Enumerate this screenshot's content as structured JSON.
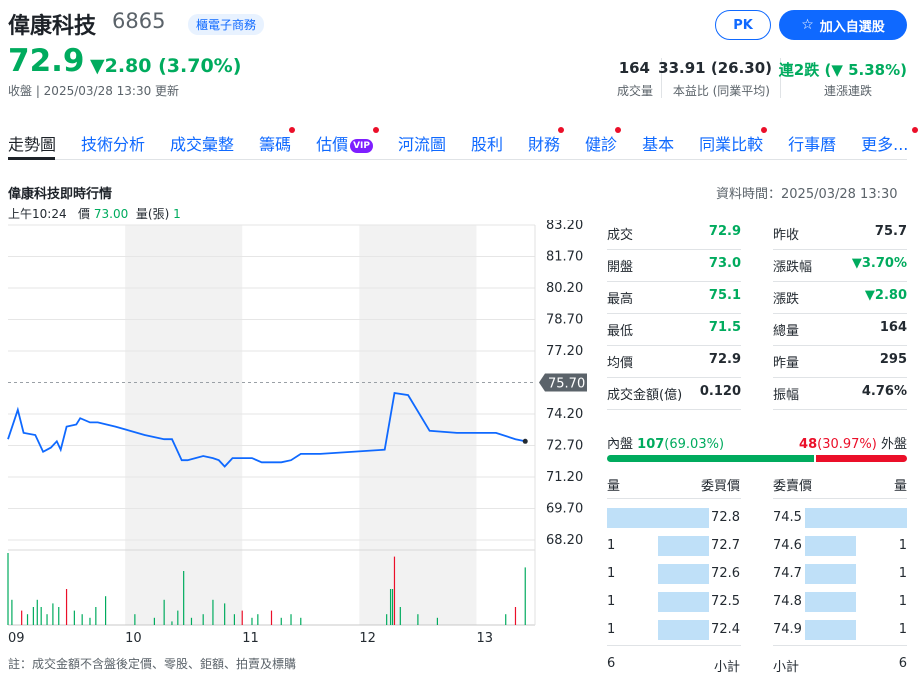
{
  "header": {
    "name": "偉康科技",
    "code": "6865",
    "sector": "櫃電子商務",
    "pk_label": "PK",
    "watch_label": "加入自選股",
    "price": "72.9",
    "change": "▼2.80 (3.70%)",
    "status": "收盤 | 2025/03/28 13:30 更新",
    "stats": [
      {
        "value": "164",
        "label": "成交量"
      },
      {
        "value": "33.91 (26.30)",
        "label": "本益比 (同業平均)"
      },
      {
        "value_prefix": "連2跌 (",
        "value_arrow": "▼",
        "value_main": "5.38%)",
        "label": "連漲連跌"
      }
    ]
  },
  "tabs": [
    "走勢圖",
    "技術分析",
    "成交彙整",
    "籌碼",
    "估價",
    "河流圖",
    "股利",
    "財務",
    "健診",
    "基本",
    "同業比較",
    "行事曆",
    "更多..."
  ],
  "vip_label": "VIP",
  "section": {
    "title": "偉康科技即時行情",
    "data_time": "資料時間：2025/03/28 13:30",
    "crosshair_time": "上午10:24",
    "crosshair_price_label": "價",
    "crosshair_price": "73.00",
    "crosshair_vol_label": "量(張)",
    "crosshair_vol": "1"
  },
  "chart_data": {
    "type": "line",
    "x_ticks": [
      "09",
      "10",
      "11",
      "12",
      "13"
    ],
    "y_ticks": [
      83.2,
      81.7,
      80.2,
      78.7,
      77.2,
      74.2,
      72.7,
      71.2,
      69.7,
      68.2
    ],
    "ylim": [
      68.2,
      83.2
    ],
    "ref_price": 75.7,
    "ref_label": "75.70",
    "price_series": [
      [
        "09:00",
        73.0
      ],
      [
        "09:05",
        74.4
      ],
      [
        "09:08",
        73.3
      ],
      [
        "09:14",
        73.2
      ],
      [
        "09:18",
        72.4
      ],
      [
        "09:22",
        72.6
      ],
      [
        "09:25",
        72.9
      ],
      [
        "09:27",
        72.5
      ],
      [
        "09:30",
        73.6
      ],
      [
        "09:35",
        73.7
      ],
      [
        "09:37",
        74.0
      ],
      [
        "09:42",
        73.8
      ],
      [
        "09:46",
        73.8
      ],
      [
        "09:55",
        73.6
      ],
      [
        "10:10",
        73.2
      ],
      [
        "10:20",
        73.0
      ],
      [
        "10:24",
        73.0
      ],
      [
        "10:26",
        72.6
      ],
      [
        "10:29",
        72.0
      ],
      [
        "10:32",
        72.0
      ],
      [
        "10:40",
        72.2
      ],
      [
        "10:45",
        72.1
      ],
      [
        "10:48",
        72.0
      ],
      [
        "10:51",
        71.7
      ],
      [
        "10:55",
        72.1
      ],
      [
        "11:05",
        72.1
      ],
      [
        "11:10",
        71.9
      ],
      [
        "11:20",
        71.9
      ],
      [
        "11:25",
        72.0
      ],
      [
        "11:30",
        72.3
      ],
      [
        "11:40",
        72.3
      ],
      [
        "12:13",
        72.5
      ],
      [
        "12:18",
        75.2
      ],
      [
        "12:25",
        75.1
      ],
      [
        "12:36",
        73.4
      ],
      [
        "12:50",
        73.3
      ],
      [
        "13:10",
        73.3
      ],
      [
        "13:20",
        73.0
      ],
      [
        "13:25",
        72.9
      ]
    ],
    "volume_series": [
      {
        "t": "09:00",
        "v": 20,
        "c": "up"
      },
      {
        "t": "09:02",
        "v": 7,
        "c": "up"
      },
      {
        "t": "09:07",
        "v": 4,
        "c": "down"
      },
      {
        "t": "09:10",
        "v": 3,
        "c": "up"
      },
      {
        "t": "09:13",
        "v": 5,
        "c": "up"
      },
      {
        "t": "09:15",
        "v": 7,
        "c": "up"
      },
      {
        "t": "09:17",
        "v": 5,
        "c": "up"
      },
      {
        "t": "09:20",
        "v": 3,
        "c": "up"
      },
      {
        "t": "09:23",
        "v": 6,
        "c": "up"
      },
      {
        "t": "09:26",
        "v": 5,
        "c": "up"
      },
      {
        "t": "09:30",
        "v": 10,
        "c": "down"
      },
      {
        "t": "09:34",
        "v": 4,
        "c": "up"
      },
      {
        "t": "09:38",
        "v": 3,
        "c": "up"
      },
      {
        "t": "09:42",
        "v": 2,
        "c": "up"
      },
      {
        "t": "09:45",
        "v": 5,
        "c": "up"
      },
      {
        "t": "09:50",
        "v": 8,
        "c": "up"
      },
      {
        "t": "10:05",
        "v": 3,
        "c": "up"
      },
      {
        "t": "10:15",
        "v": 2,
        "c": "up"
      },
      {
        "t": "10:20",
        "v": 7,
        "c": "up"
      },
      {
        "t": "10:24",
        "v": 1,
        "c": "up"
      },
      {
        "t": "10:27",
        "v": 4,
        "c": "up"
      },
      {
        "t": "10:30",
        "v": 15,
        "c": "up"
      },
      {
        "t": "10:34",
        "v": 2,
        "c": "up"
      },
      {
        "t": "10:40",
        "v": 3,
        "c": "up"
      },
      {
        "t": "10:45",
        "v": 7,
        "c": "up"
      },
      {
        "t": "10:51",
        "v": 6,
        "c": "up"
      },
      {
        "t": "10:56",
        "v": 3,
        "c": "up"
      },
      {
        "t": "11:00",
        "v": 4,
        "c": "down"
      },
      {
        "t": "11:05",
        "v": 2,
        "c": "up"
      },
      {
        "t": "11:08",
        "v": 3,
        "c": "up"
      },
      {
        "t": "11:15",
        "v": 4,
        "c": "down"
      },
      {
        "t": "11:20",
        "v": 2,
        "c": "up"
      },
      {
        "t": "11:25",
        "v": 3,
        "c": "up"
      },
      {
        "t": "11:30",
        "v": 2,
        "c": "up"
      },
      {
        "t": "12:14",
        "v": 3,
        "c": "up"
      },
      {
        "t": "12:16",
        "v": 10,
        "c": "up"
      },
      {
        "t": "12:17",
        "v": 10,
        "c": "up"
      },
      {
        "t": "12:18",
        "v": 19,
        "c": "down"
      },
      {
        "t": "12:21",
        "v": 5,
        "c": "up"
      },
      {
        "t": "12:30",
        "v": 3,
        "c": "up"
      },
      {
        "t": "12:40",
        "v": 2,
        "c": "up"
      },
      {
        "t": "13:15",
        "v": 3,
        "c": "up"
      },
      {
        "t": "13:20",
        "v": 5,
        "c": "down"
      },
      {
        "t": "13:25",
        "v": 16,
        "c": "up"
      }
    ]
  },
  "quote": {
    "left": [
      {
        "label": "成交",
        "value": "72.9",
        "color": "green"
      },
      {
        "label": "開盤",
        "value": "73.0",
        "color": "green"
      },
      {
        "label": "最高",
        "value": "75.1",
        "color": "green"
      },
      {
        "label": "最低",
        "value": "71.5",
        "color": "green"
      },
      {
        "label": "均價",
        "value": "72.9",
        "color": "dark"
      },
      {
        "label": "成交金額(億)",
        "value": "0.120",
        "color": "dark"
      }
    ],
    "right": [
      {
        "label": "昨收",
        "value": "75.7",
        "color": "dark"
      },
      {
        "label": "漲跌幅",
        "value": "▼3.70%",
        "color": "green"
      },
      {
        "label": "漲跌",
        "value": "▼2.80",
        "color": "green"
      },
      {
        "label": "總量",
        "value": "164",
        "color": "dark"
      },
      {
        "label": "昨量",
        "value": "295",
        "color": "dark"
      },
      {
        "label": "振幅",
        "value": "4.76%",
        "color": "dark"
      }
    ]
  },
  "orderbook": {
    "inner_label": "內盤",
    "inner_value": "107",
    "inner_pct": "(69.03%)",
    "outer_value": "48",
    "outer_pct": "(30.97%)",
    "outer_label": "外盤",
    "inner_ratio": 0.6903,
    "head_bid_qty": "量",
    "head_bid_price": "委買價",
    "head_ask_price": "委賣價",
    "head_ask_qty": "量",
    "bids": [
      {
        "qty": "2",
        "price": "72.8",
        "ratio": 1.0
      },
      {
        "qty": "1",
        "price": "72.7",
        "ratio": 0.5
      },
      {
        "qty": "1",
        "price": "72.6",
        "ratio": 0.5
      },
      {
        "qty": "1",
        "price": "72.5",
        "ratio": 0.5
      },
      {
        "qty": "1",
        "price": "72.4",
        "ratio": 0.5
      }
    ],
    "asks": [
      {
        "price": "74.5",
        "qty": "2",
        "ratio": 1.0
      },
      {
        "price": "74.6",
        "qty": "1",
        "ratio": 0.5
      },
      {
        "price": "74.7",
        "qty": "1",
        "ratio": 0.5
      },
      {
        "price": "74.8",
        "qty": "1",
        "ratio": 0.5
      },
      {
        "price": "74.9",
        "qty": "1",
        "ratio": 0.5
      }
    ],
    "bid_total": "6",
    "subtotal_label": "小計",
    "ask_total": "6"
  },
  "footnote": "註：成交金額不含盤後定價、零股、鉅額、拍賣及標購",
  "colors": {
    "green": "#00ab5e",
    "red": "#eb0f29",
    "blue": "#0f69ff",
    "line": "#0f69ff",
    "bar_bg": "#bfe0f8"
  }
}
